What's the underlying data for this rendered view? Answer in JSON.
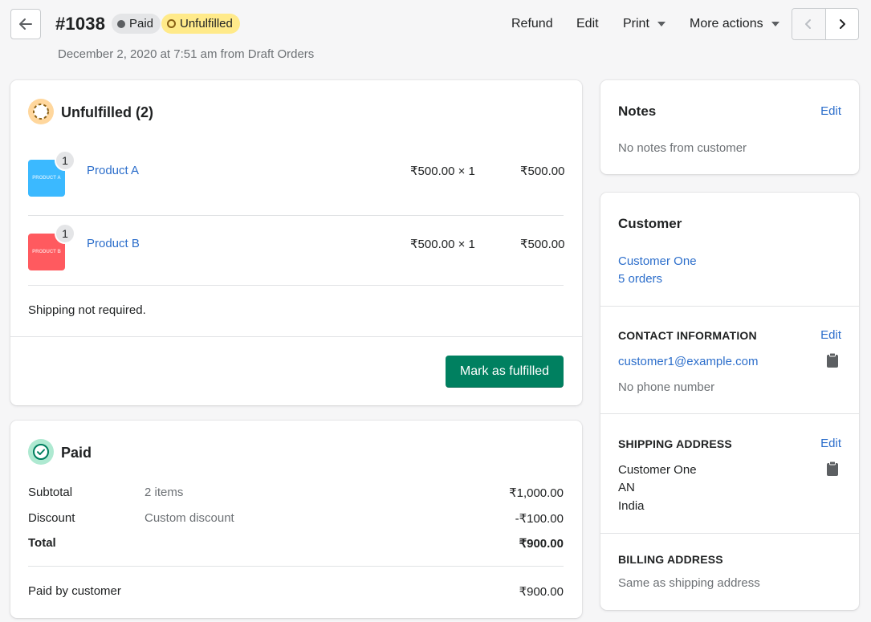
{
  "header": {
    "title": "#1038",
    "badge_paid": "Paid",
    "badge_unfulfilled": "Unfulfilled",
    "subtitle": "December 2, 2020 at 7:51 am from Draft Orders",
    "actions": {
      "refund": "Refund",
      "edit": "Edit",
      "print": "Print",
      "more": "More actions"
    }
  },
  "unfulfilled": {
    "heading": "Unfulfilled (2)",
    "items": [
      {
        "name": "Product A",
        "qty": "1",
        "thumb_text": "PRODUCT A",
        "thumb_color": "#3bb9ff",
        "unit": "₹500.00 × 1",
        "total": "₹500.00"
      },
      {
        "name": "Product B",
        "qty": "1",
        "thumb_text": "PRODUCT B",
        "thumb_color": "#ff5a5f",
        "unit": "₹500.00 × 1",
        "total": "₹500.00"
      }
    ],
    "shipping_note": "Shipping not required.",
    "button": "Mark as fulfilled"
  },
  "paid": {
    "heading": "Paid",
    "rows": [
      {
        "label": "Subtotal",
        "desc": "2 items",
        "amount": "₹1,000.00"
      },
      {
        "label": "Discount",
        "desc": "Custom discount",
        "amount": "-₹100.00"
      },
      {
        "label": "Total",
        "desc": "",
        "amount": "₹900.00"
      }
    ],
    "paid_by_label": "Paid by customer",
    "paid_by_amount": "₹900.00"
  },
  "notes": {
    "heading": "Notes",
    "edit": "Edit",
    "text": "No notes from customer"
  },
  "customer": {
    "heading": "Customer",
    "name": "Customer One",
    "orders": "5 orders",
    "contact": {
      "label": "CONTACT INFORMATION",
      "edit": "Edit",
      "email": "customer1@example.com",
      "phone": "No phone number"
    },
    "shipping": {
      "label": "SHIPPING ADDRESS",
      "edit": "Edit",
      "lines": [
        "Customer One",
        "AN",
        "India"
      ]
    },
    "billing": {
      "label": "BILLING ADDRESS",
      "text": "Same as shipping address"
    }
  },
  "colors": {
    "primary": "#008060",
    "link": "#2c6ecb",
    "unfulfilled_badge": "#ffea8a",
    "paid_badge": "#e4e5e7"
  },
  "icons": [
    "arrow-left-icon",
    "chevron-left-icon",
    "chevron-right-icon",
    "unfulfilled-status-icon",
    "paid-check-icon",
    "clipboard-icon"
  ]
}
